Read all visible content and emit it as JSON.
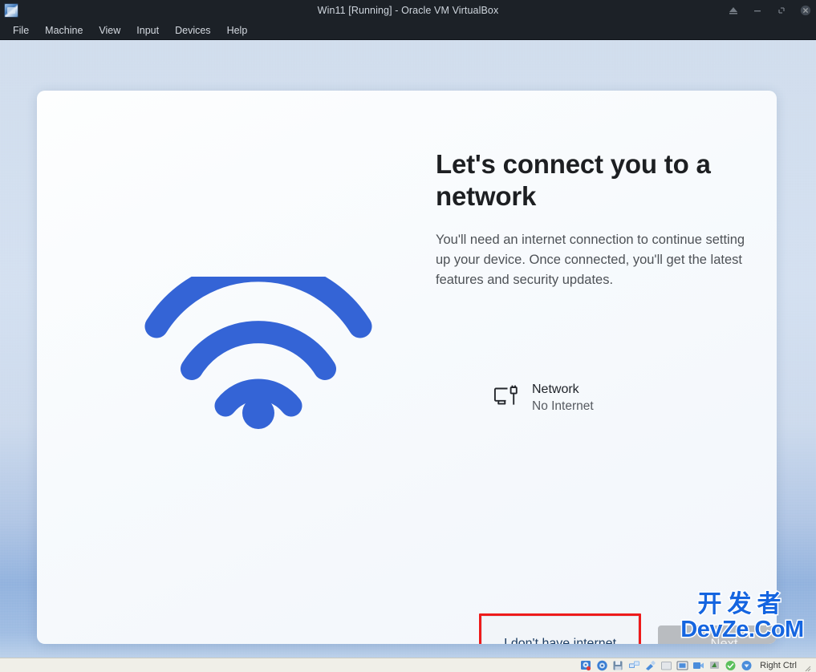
{
  "window": {
    "title": "Win11 [Running] - Oracle VM VirtualBox",
    "app_icon": "virtualbox-icon",
    "controls": [
      {
        "name": "minimize-to-tray-button",
        "icon": "tray-icon",
        "label": ""
      },
      {
        "name": "minimize-button",
        "icon": "minimize-icon",
        "label": ""
      },
      {
        "name": "restore-button",
        "icon": "restore-icon",
        "label": ""
      },
      {
        "name": "close-button",
        "icon": "close-icon",
        "label": ""
      }
    ]
  },
  "menubar": {
    "items": [
      {
        "label": "File"
      },
      {
        "label": "Machine"
      },
      {
        "label": "View"
      },
      {
        "label": "Input"
      },
      {
        "label": "Devices"
      },
      {
        "label": "Help"
      }
    ]
  },
  "oobe": {
    "heading": "Let's connect you to a network",
    "subtext": "You'll need an internet connection to continue setting up your device. Once connected, you'll get the latest features and security updates.",
    "illustration_icon": "wifi-icon",
    "network": {
      "icon": "ethernet-pc-icon",
      "name": "Network",
      "status": "No Internet"
    },
    "buttons": {
      "no_internet_label": "I don't have internet",
      "next_label": "Next",
      "next_disabled": true,
      "highlight_color": "#ee1b1b"
    }
  },
  "watermark": {
    "line1": "开发者",
    "line2": "DevZe.CoM",
    "color": "#1565e0"
  },
  "statusbar": {
    "icons": [
      {
        "name": "hard-disk-icon"
      },
      {
        "name": "optical-drive-icon"
      },
      {
        "name": "floppy-drive-icon"
      },
      {
        "name": "network-adapter-icon"
      },
      {
        "name": "usb-icon"
      },
      {
        "name": "shared-folders-icon"
      },
      {
        "name": "display-icon"
      },
      {
        "name": "recording-icon"
      },
      {
        "name": "mouse-integration-icon"
      },
      {
        "name": "keyboard-capture-icon"
      },
      {
        "name": "host-key-icon"
      }
    ],
    "host_key": "Right Ctrl"
  },
  "colors": {
    "titlebar_bg": "#1c2127",
    "vm_bg_top": "#cfdcec",
    "vm_bg_bottom": "#8fb0dd",
    "card_bg": "#fdfefe",
    "wifi_blue": "#3464d6",
    "next_bg": "#b9bcc0"
  }
}
